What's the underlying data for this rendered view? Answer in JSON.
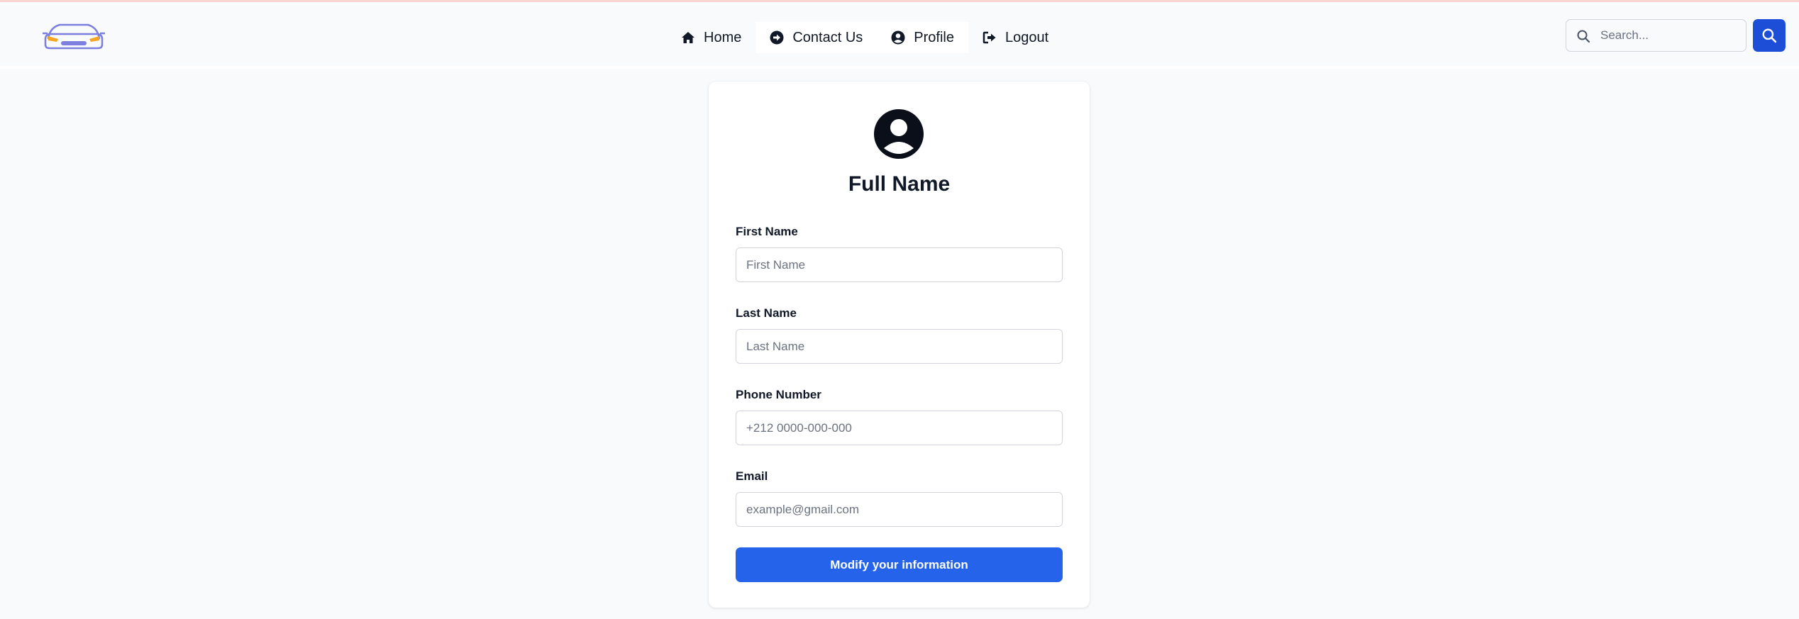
{
  "colors": {
    "primary": "#2563eb",
    "primary_dark": "#1d4ed8",
    "text": "#111827",
    "background": "#f8fafc",
    "logo_purple": "#7c7ee0",
    "logo_orange": "#f5a623"
  },
  "navbar": {
    "logo_icon": "car-logo",
    "links": [
      {
        "label": "Home",
        "icon": "home-icon"
      },
      {
        "label": "Contact Us",
        "icon": "arrow-circle-right-icon"
      },
      {
        "label": "Profile",
        "icon": "user-circle-icon"
      },
      {
        "label": "Logout",
        "icon": "sign-out-icon"
      }
    ],
    "search": {
      "placeholder": "Search...",
      "value": "",
      "icon": "search-icon"
    },
    "search_button_icon": "search-icon"
  },
  "profile": {
    "avatar_icon": "user-circle-icon",
    "title": "Full Name",
    "fields": [
      {
        "label": "First Name",
        "placeholder": "First Name",
        "value": ""
      },
      {
        "label": "Last Name",
        "placeholder": "Last Name",
        "value": ""
      },
      {
        "label": "Phone Number",
        "placeholder": "+212 0000-000-000",
        "value": ""
      },
      {
        "label": "Email",
        "placeholder": "example@gmail.com",
        "value": ""
      }
    ],
    "submit_label": "Modify your information"
  }
}
